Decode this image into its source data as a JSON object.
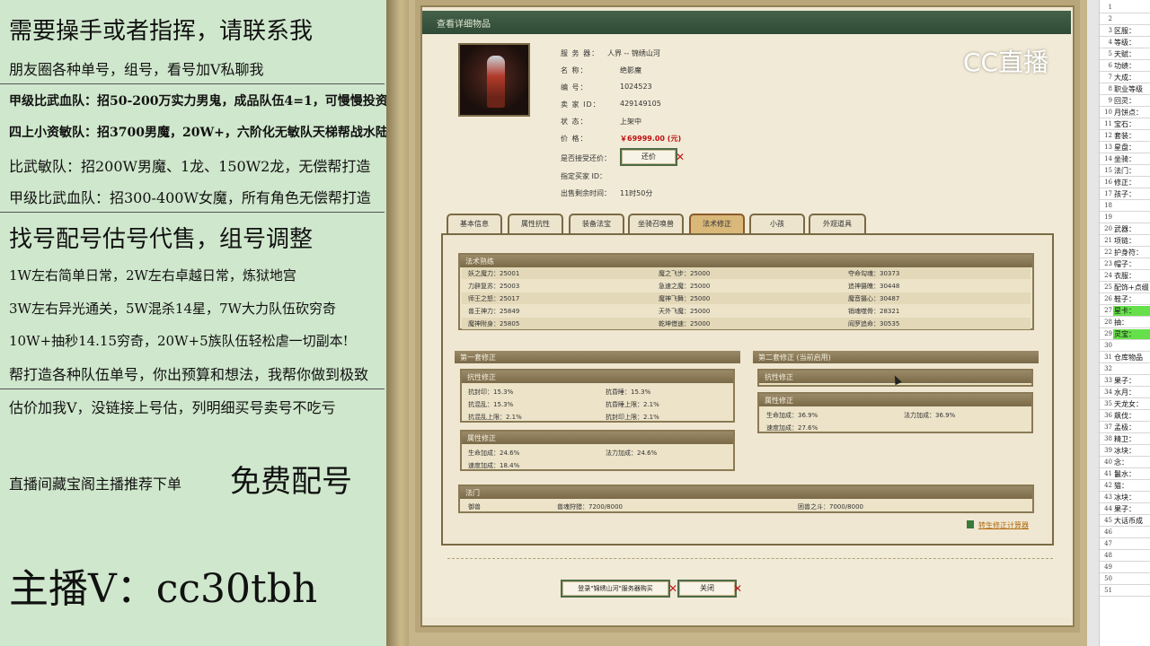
{
  "left_panel": {
    "lines": [
      "需要操手或者指挥，请联系我",
      "朋友圈各种单号，组号，看号加V私聊我",
      "甲级比武血队：招50-200万实力男鬼，成品队伍4=1，可慢慢投资",
      "四上小资敏队：招3700男魔，20W+，六阶化无敏队天梯帮战水陆4等1",
      "比武敏队：招200W男魔、1龙、150W2龙，无偿帮打造",
      "甲级比武血队：招300-400W女魔，所有角色无偿帮打造",
      "找号配号估号代售，组号调整",
      "1W左右简单日常，2W左右卓越日常，炼狱地宫",
      "3W左右异光通关，5W混杀14星，7W大力队伍砍穷奇",
      "10W+抽秒14.15穷奇，20W+5族队伍轻松虐一切副本!",
      "帮打造各种队伍单号，你出预算和想法，我帮你做到极致",
      "估价加我V，没链接上号估，列明细买号卖号不吃亏",
      "直播间藏宝阁主播推荐下单",
      "免费配号",
      "主播V：cc30tbh"
    ]
  },
  "window": {
    "title": "查看详细物品",
    "info": {
      "server_label": "服 务 器：",
      "server_value": "人界 -- 锦绣山河",
      "name_label": "名      称：",
      "name_value": "绝影魔",
      "number_label": "编      号：",
      "number_value": "1024523",
      "seller_label": "卖  家  ID：",
      "seller_value": "429149105",
      "status_label": "状      态：",
      "status_value": "上架中",
      "price_label": "价      格：",
      "price_value": "￥69999.00 (元)",
      "bargain_label": "是否接受还价：",
      "bargain_button": "还价",
      "buyer_label": "指定买家 ID：",
      "time_label": "出售剩余时间：",
      "time_value": "11时50分"
    },
    "tabs": [
      "基本信息",
      "属性抗性",
      "装备法宝",
      "坐骑召唤兽",
      "法术修正",
      "小孩",
      "外观道具"
    ],
    "active_tab": "法术修正",
    "spell_section": {
      "title": "法术熟练",
      "col1": [
        "妖之魔力：25001",
        "力辟复苏：25003",
        "师王之怒：25017",
        "兽王神力：25849",
        "魔神附身：25805"
      ],
      "col2": [
        "魔之飞步：25000",
        "急速之魔：25000",
        "魔神飞舞：25000",
        "天外飞魔：25000",
        "乾坤借速：25000"
      ],
      "col3": [
        "夺命勾魂：30373",
        "追神摄魄：30448",
        "魔音摄心：30487",
        "销魂噬骨：28321",
        "阎罗追命：30535"
      ]
    },
    "set1": {
      "title": "第一套修正",
      "resist_title": "抗性修正",
      "resist": [
        "抗封印：15.3%",
        "抗昏睡：15.3%",
        "抗混乱：15.3%",
        "抗昏睡上限：2.1%",
        "抗混乱上限：2.1%",
        "抗封印上限：2.1%"
      ],
      "attr_title": "属性修正",
      "attr": [
        "生命加成：24.6%",
        "法力加成：24.6%",
        "速度加成：18.4%"
      ]
    },
    "set2": {
      "title": "第二套修正 (当前启用)",
      "resist_title": "抗性修正",
      "attr_title": "属性修正",
      "attr": [
        "生命加成：36.9%",
        "法力加成：36.9%",
        "速度加成：27.6%"
      ]
    },
    "fa_men": {
      "title": "法门",
      "items": [
        "御兽",
        "兽魂狩猎：7200/8000",
        "困兽之斗：7000/8000"
      ]
    },
    "calc_link": "转生修正计算器",
    "login_button": "登录\"锦绣山河\"服务器购买",
    "close_button": "关闭"
  },
  "logo_text": "CC直播",
  "sheet": {
    "rows": [
      {
        "n": "1",
        "t": ""
      },
      {
        "n": "2",
        "t": ""
      },
      {
        "n": "3",
        "t": "区服："
      },
      {
        "n": "4",
        "t": "等级："
      },
      {
        "n": "5",
        "t": "天赋："
      },
      {
        "n": "6",
        "t": "功绩："
      },
      {
        "n": "7",
        "t": "大成："
      },
      {
        "n": "8",
        "t": "职业等级"
      },
      {
        "n": "9",
        "t": "回灵："
      },
      {
        "n": "10",
        "t": "月饼点："
      },
      {
        "n": "11",
        "t": "宝石："
      },
      {
        "n": "12",
        "t": "套装："
      },
      {
        "n": "13",
        "t": "星盘："
      },
      {
        "n": "14",
        "t": "坐骑："
      },
      {
        "n": "15",
        "t": "法门："
      },
      {
        "n": "16",
        "t": "修正："
      },
      {
        "n": "17",
        "t": "孩子："
      },
      {
        "n": "18",
        "t": ""
      },
      {
        "n": "19",
        "t": ""
      },
      {
        "n": "20",
        "t": "武器："
      },
      {
        "n": "21",
        "t": "项链："
      },
      {
        "n": "22",
        "t": "护身符："
      },
      {
        "n": "23",
        "t": "帽子："
      },
      {
        "n": "24",
        "t": "衣服："
      },
      {
        "n": "25",
        "t": "配饰+点缀"
      },
      {
        "n": "26",
        "t": "鞋子："
      },
      {
        "n": "27",
        "t": "星卡："
      },
      {
        "n": "28",
        "t": "抽："
      },
      {
        "n": "29",
        "t": "灵宝："
      },
      {
        "n": "30",
        "t": ""
      },
      {
        "n": "31",
        "t": "仓库物品"
      },
      {
        "n": "32",
        "t": ""
      },
      {
        "n": "33",
        "t": "果子："
      },
      {
        "n": "34",
        "t": "水月："
      },
      {
        "n": "35",
        "t": "天龙女："
      },
      {
        "n": "36",
        "t": "飙伐："
      },
      {
        "n": "37",
        "t": "孟极："
      },
      {
        "n": "38",
        "t": "精卫："
      },
      {
        "n": "39",
        "t": "冰块："
      },
      {
        "n": "40",
        "t": "念："
      },
      {
        "n": "41",
        "t": "鬣水："
      },
      {
        "n": "42",
        "t": "猫："
      },
      {
        "n": "43",
        "t": "冰块："
      },
      {
        "n": "44",
        "t": "果子："
      },
      {
        "n": "45",
        "t": "大话币成"
      },
      {
        "n": "46",
        "t": ""
      },
      {
        "n": "47",
        "t": ""
      },
      {
        "n": "48",
        "t": ""
      },
      {
        "n": "49",
        "t": ""
      },
      {
        "n": "50",
        "t": ""
      },
      {
        "n": "51",
        "t": ""
      }
    ],
    "highlight_color": "#66e04a"
  }
}
